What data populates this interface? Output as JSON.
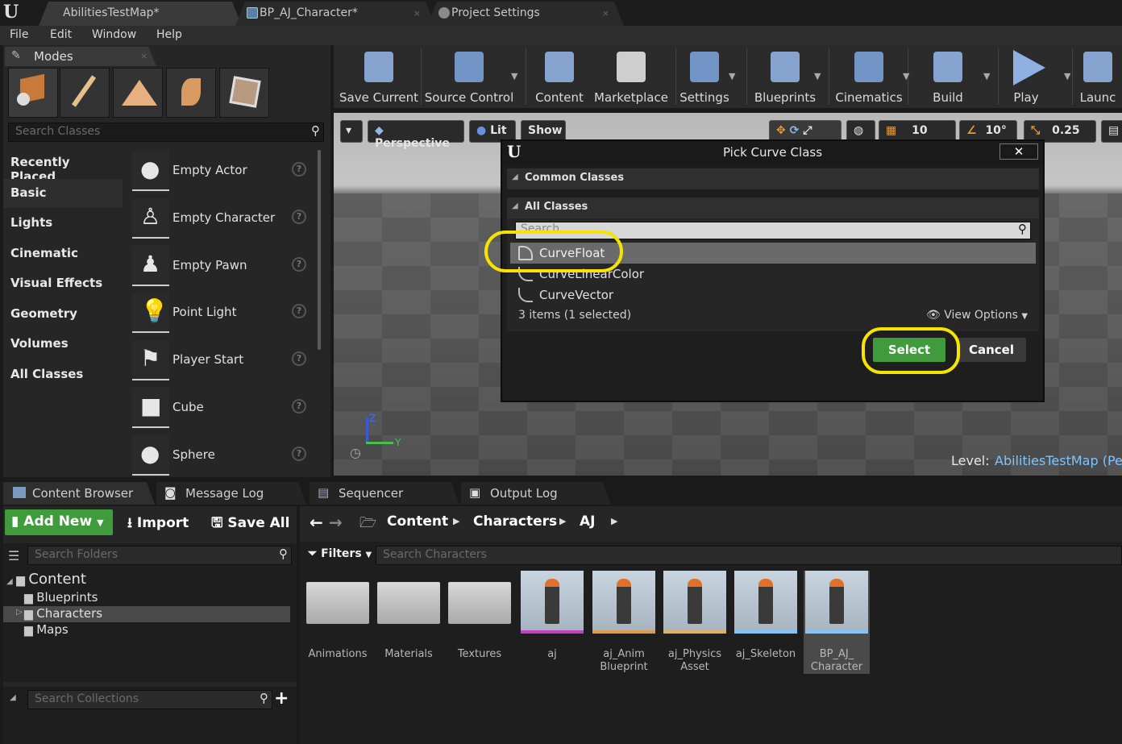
{
  "tabs": [
    {
      "label": "AbilitiesTestMap*",
      "active": true
    },
    {
      "label": "BP_AJ_Character*",
      "active": false
    },
    {
      "label": "Project Settings",
      "active": false
    }
  ],
  "menu": [
    "File",
    "Edit",
    "Window",
    "Help"
  ],
  "modes": {
    "title": "Modes",
    "search_placeholder": "Search Classes",
    "categories": [
      "Recently Placed",
      "Basic",
      "Lights",
      "Cinematic",
      "Visual Effects",
      "Geometry",
      "Volumes",
      "All Classes"
    ],
    "selected_category": "Basic",
    "items": [
      "Empty Actor",
      "Empty Character",
      "Empty Pawn",
      "Point Light",
      "Player Start",
      "Cube",
      "Sphere"
    ]
  },
  "toolbar": [
    "Save Current",
    "Source Control",
    "Content",
    "Marketplace",
    "Settings",
    "Blueprints",
    "Cinematics",
    "Build",
    "Play",
    "Launc"
  ],
  "viewport": {
    "perspective": "Perspective",
    "lit": "Lit",
    "show": "Show",
    "grid_snap": "10",
    "rot_snap": "10°",
    "scale_snap": "0.25",
    "level_label": "Level:",
    "level_name": "AbilitiesTestMap (Per",
    "axis_z": "Z",
    "axis_y": "Y"
  },
  "dialog": {
    "title": "Pick Curve Class",
    "common_classes": "Common Classes",
    "all_classes": "All Classes",
    "search_placeholder": "Search",
    "items": [
      "CurveFloat",
      "CurveLinearColor",
      "CurveVector"
    ],
    "selected_item": "CurveFloat",
    "status": "3 items (1 selected)",
    "view_options": "View Options",
    "select_label": "Select",
    "cancel_label": "Cancel"
  },
  "bottom_tabs": [
    "Content Browser",
    "Message Log",
    "Sequencer",
    "Output Log"
  ],
  "content_browser": {
    "add_new": "Add New",
    "import": "Import",
    "save_all": "Save All",
    "breadcrumb": [
      "Content",
      "Characters",
      "AJ"
    ],
    "search_folders": "Search Folders",
    "filters": "Filters",
    "search_assets": "Search Characters",
    "search_collections": "Search Collections",
    "tree": {
      "root": "Content",
      "children": [
        "Blueprints",
        "Characters",
        "Maps"
      ],
      "selected": "Characters"
    },
    "assets": [
      "Animations",
      "Materials",
      "Textures",
      "aj",
      "aj_Anim\nBlueprint",
      "aj_Physics\nAsset",
      "aj_Skeleton",
      "BP_AJ_\nCharacter"
    ]
  },
  "colors": {
    "accent_green": "#3f9b3b",
    "highlight_yellow": "#f5e400",
    "link_blue": "#7fc3ff"
  }
}
